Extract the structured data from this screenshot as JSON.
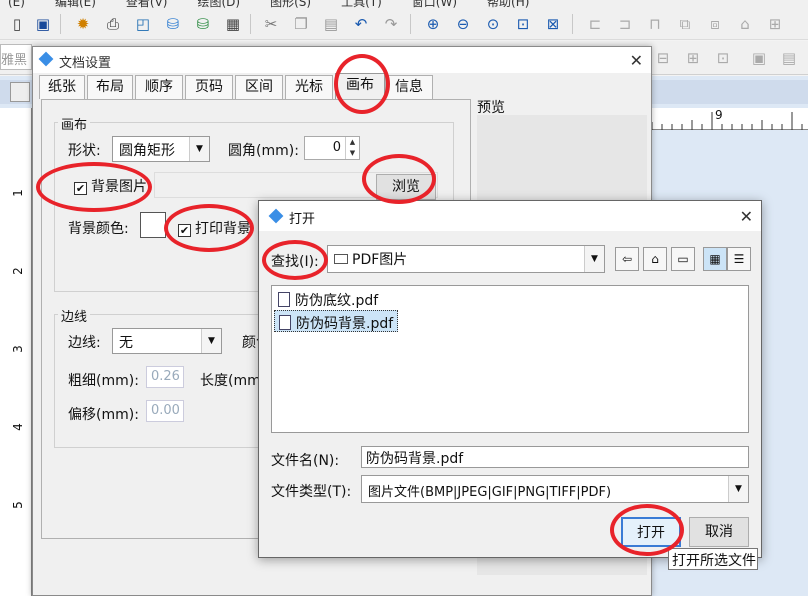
{
  "app": {
    "menu_items": [
      "(E)",
      "编辑(E)",
      "查看(V)",
      "绘图(D)",
      "图形(S)",
      "工具(T)",
      "窗口(W)",
      "帮助(H)"
    ],
    "font_name": "雅黑"
  },
  "doc_dialog": {
    "title": "文档设置",
    "tabs": [
      "纸张",
      "布局",
      "顺序",
      "页码",
      "区间",
      "光标",
      "画布",
      "信息"
    ],
    "active_tab": "画布",
    "canvas_group": {
      "label": "画布",
      "shape_label": "形状:",
      "shape_value": "圆角矩形",
      "corner_label": "圆角(mm):",
      "corner_value": "0",
      "bg_image_label": "背景图片",
      "bg_image_checked": true,
      "browse_label": "浏览",
      "bg_color_label": "背景颜色:",
      "print_bg_label": "打印背景",
      "print_bg_checked": true
    },
    "border_group": {
      "label": "边线",
      "border_label": "边线:",
      "border_value": "无",
      "color_label": "颜色",
      "thickness_label": "粗细(mm):",
      "thickness_value": "0.26",
      "length_label": "长度(mm)",
      "offset_label": "偏移(mm):",
      "offset_value": "0.00"
    },
    "preview_label": "预览"
  },
  "open_dialog": {
    "title": "打开",
    "lookin_label": "查找(I):",
    "lookin_value": "PDF图片",
    "files": [
      "防伪底纹.pdf",
      "防伪码背景.pdf"
    ],
    "selected_file": "防伪码背景.pdf",
    "filename_label": "文件名(N):",
    "filename_value": "防伪码背景.pdf",
    "filetype_label": "文件类型(T):",
    "filetype_value": "图片文件(BMP|JPEG|GIF|PNG|TIFF|PDF)",
    "open_button": "打开",
    "cancel_button": "取消",
    "tooltip": "打开所选文件"
  },
  "ruler": {
    "top_label": "9",
    "left_labels": [
      "1",
      "2",
      "3",
      "4",
      "5"
    ]
  },
  "colors": {
    "highlight_ring": "#e8232a",
    "selection": "#cce4f7"
  }
}
